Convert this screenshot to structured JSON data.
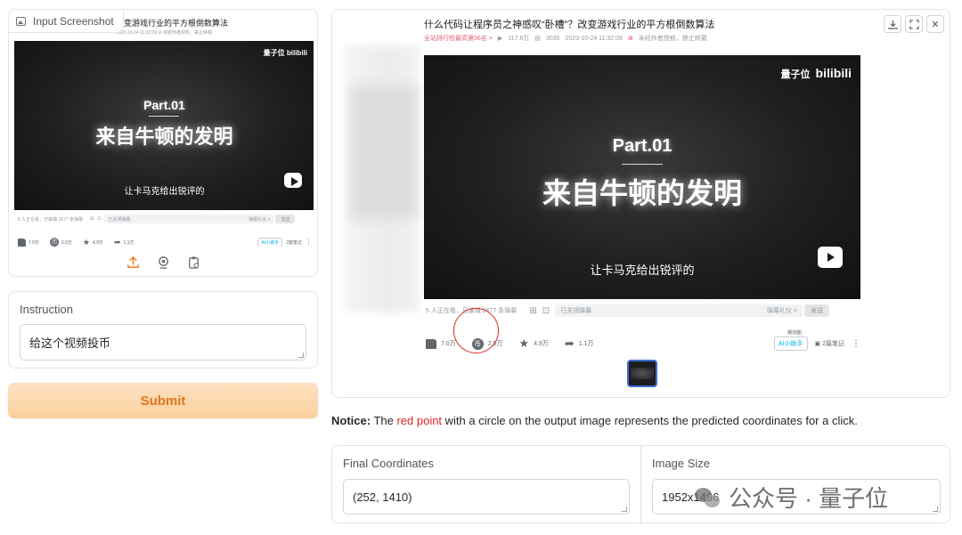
{
  "input_panel": {
    "tag_label": "Input Screenshot",
    "close_glyph": "✕",
    "preview": {
      "title": "改变游戏行业的平方根倒数算法",
      "meta": "2023-10-24 11:32:09 ⊘ 未经作者授权，禁止转载",
      "logo": "量子位 bilibili",
      "part_text": "Part.01",
      "headline": "来自牛顿的发明",
      "subtitle": "让卡马克给出锐评的",
      "danmaku_info": "5 人正在看，已装填 2677 条弹幕",
      "danmaku_placeholder": "已关闭弹幕",
      "danmaku_etiquette": "弹幕礼仪 >",
      "send_label": "发送",
      "like_count": "7.0万",
      "coin_count": "2.5万",
      "fav_count": "4.9万",
      "share_count": "1.1万",
      "ai_label": "AI小助手",
      "note_label": "2篇笔记"
    },
    "tool_icons": [
      "upload-icon",
      "webcam-icon",
      "clipboard-icon"
    ]
  },
  "instruction": {
    "label": "Instruction",
    "value": "给这个视频投币"
  },
  "submit_label": "Submit",
  "output_panel": {
    "tool_icons": [
      "download-icon",
      "fullscreen-icon",
      "close-icon"
    ],
    "preview": {
      "title": "什么代码让程序员之神感叹“卧槽”？改变游戏行业的平方根倒数算法",
      "rank": "全站排行榜最高第56名 >",
      "views": "117.8万",
      "danmaku_count": "3035",
      "date": "2023-10-24 11:32:09",
      "copyright": "未经作者授权，禁止转载",
      "logo_cn": "量子位",
      "logo_en": "bilibili",
      "part_text": "Part.01",
      "headline": "来自牛顿的发明",
      "subtitle": "让卡马克给出锐评的",
      "danmaku_info": "5 人正在看，已装填 2677 条弹幕",
      "danmaku_placeholder": "已关闭弹幕",
      "danmaku_etiquette": "弹幕礼仪 >",
      "send_label": "发送",
      "like_count": "7.0万",
      "coin_count": "2.5万",
      "fav_count": "4.9万",
      "share_count": "1.1万",
      "ai_badge": "新功能",
      "ai_label": "AI小助手",
      "note_label": "2篇笔记"
    }
  },
  "notice": {
    "prefix": "Notice:",
    "text_before": " The ",
    "highlight": "red point",
    "text_after": " with a circle on the output image represents the predicted coordinates for a click."
  },
  "final_coordinates": {
    "label": "Final Coordinates",
    "value": "(252, 1410)"
  },
  "image_size": {
    "label": "Image Size",
    "value": "1952x1466"
  },
  "watermark": "公众号 · 量子位",
  "colors": {
    "accent_orange": "#e0761b",
    "click_red": "#dc2626",
    "bili_pink": "#e2627a",
    "bili_blue": "#00aeec"
  }
}
